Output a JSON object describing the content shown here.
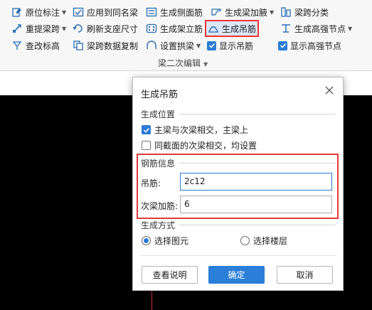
{
  "ribbon": {
    "row1": [
      {
        "label": "原位标注",
        "icon": "annotation-icon",
        "dropdown": true
      },
      {
        "label": "应用到同名梁",
        "icon": "apply-same-icon",
        "dropdown": false
      },
      {
        "label": "生成侧面筋",
        "icon": "side-bar-icon",
        "dropdown": false
      },
      {
        "label": "生成梁加腋",
        "icon": "haunch-icon",
        "dropdown": true
      },
      {
        "label": "梁跨分类",
        "icon": "span-class-icon",
        "dropdown": false
      }
    ],
    "row2": [
      {
        "label": "重提梁跨",
        "icon": "re-extract-icon",
        "dropdown": true
      },
      {
        "label": "刷新支座尺寸",
        "icon": "refresh-support-icon",
        "dropdown": false
      },
      {
        "label": "生成架立筋",
        "icon": "erection-bar-icon",
        "dropdown": false
      },
      {
        "label": "生成吊筋",
        "icon": "hanger-bar-icon",
        "dropdown": false
      },
      {
        "label": "生成高强节点",
        "icon": "high-strength-icon",
        "dropdown": true
      }
    ],
    "row3": [
      {
        "label": "查改标高",
        "icon": "elevation-icon",
        "dropdown": false
      },
      {
        "label": "梁跨数据复制",
        "icon": "copy-span-icon",
        "dropdown": false
      },
      {
        "label": "设置拱梁",
        "icon": "arch-beam-icon",
        "dropdown": true
      },
      {
        "label": "显示吊筋",
        "icon": "checkbox-icon",
        "checked": true
      },
      {
        "label": "显示高强节点",
        "icon": "checkbox-icon",
        "checked": true
      }
    ],
    "group_label": "梁二次编辑"
  },
  "dialog": {
    "title": "生成吊筋",
    "position_section": "生成位置",
    "opt_main_secondary": "主梁与次梁相交，主梁上",
    "opt_main_secondary_checked": true,
    "opt_same_section": "同截面的次梁相交，均设置",
    "opt_same_section_checked": false,
    "rebar_section": "钢筋信息",
    "hanger_label": "吊筋:",
    "hanger_value": "2c12",
    "secondary_label": "次梁加筋:",
    "secondary_value": "6",
    "method_section": "生成方式",
    "radio_select_element": "选择图元",
    "radio_select_floor": "选择楼层",
    "selected_method": "选择图元",
    "btn_help": "查看说明",
    "btn_ok": "确定",
    "btn_cancel": "取消"
  },
  "colors": {
    "accent": "#2b7fd8",
    "highlight_border": "#e03a3a",
    "canvas": "#000000"
  }
}
